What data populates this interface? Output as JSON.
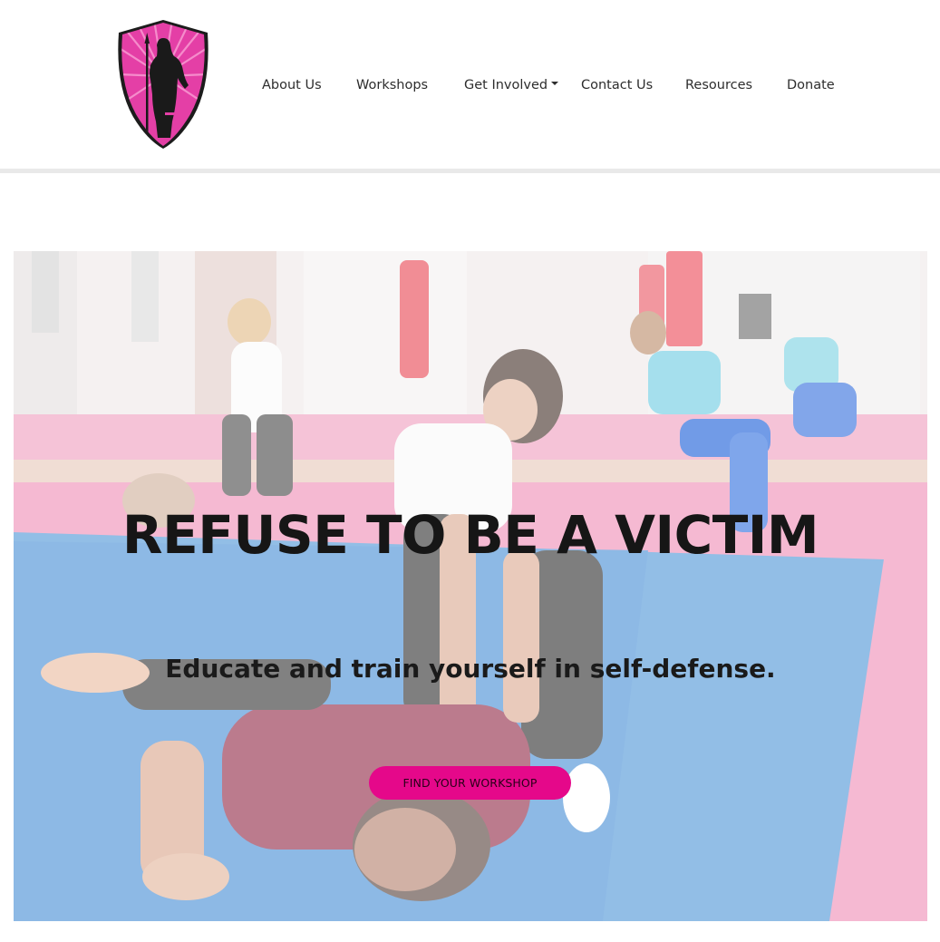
{
  "site": {
    "logo_icon": "shield-warrior-silhouette-icon",
    "brand_color": "#e5088a"
  },
  "nav": {
    "items": [
      {
        "label": "About Us"
      },
      {
        "label": "Workshops"
      },
      {
        "label": "Get Involved",
        "has_dropdown": true
      },
      {
        "label": "Contact Us"
      },
      {
        "label": "Resources"
      },
      {
        "label": "Donate"
      }
    ]
  },
  "hero": {
    "title": "REFUSE TO BE A VICTIM",
    "subtitle": "Educate and train yourself in self-defense.",
    "cta_label": "FIND YOUR WORKSHOP"
  }
}
